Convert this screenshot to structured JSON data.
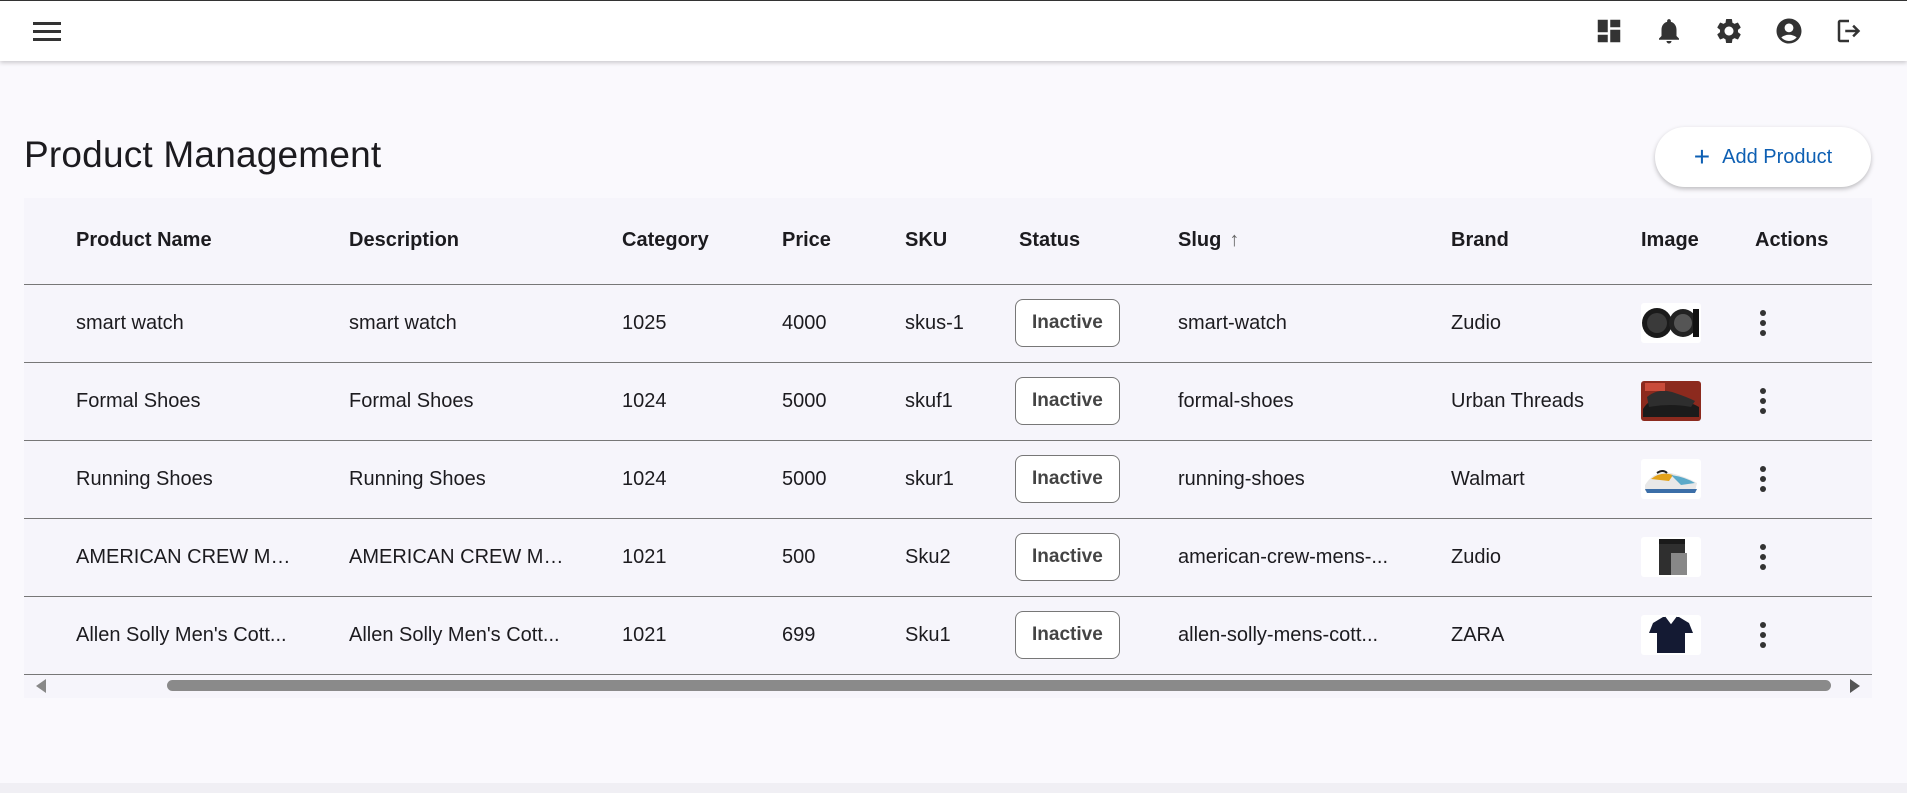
{
  "header": {
    "menu_icon": "hamburger-menu-icon",
    "icons": [
      "dashboard-icon",
      "bell-icon",
      "gear-icon",
      "account-circle-icon",
      "logout-icon"
    ]
  },
  "page": {
    "title": "Product Management",
    "add_button_label": "Add Product",
    "add_button_icon": "plus-icon",
    "accent": "#0d5fb3"
  },
  "table": {
    "columns": [
      "Product Name",
      "Description",
      "Category",
      "Price",
      "SKU",
      "Status",
      "Slug",
      "Brand",
      "Image",
      "Actions"
    ],
    "sorted_column": "Slug",
    "sort_direction": "ascending",
    "rows": [
      {
        "name": "smart watch",
        "description": "smart watch",
        "category": "1025",
        "price": "4000",
        "sku": "skus-1",
        "status": "Inactive",
        "slug": "smart-watch",
        "brand": "Zudio",
        "image": "watch-thumbnail"
      },
      {
        "name": "Formal Shoes",
        "description": "Formal Shoes",
        "category": "1024",
        "price": "5000",
        "sku": "skuf1",
        "status": "Inactive",
        "slug": "formal-shoes",
        "brand": "Urban Threads",
        "image": "formal-shoes-thumbnail"
      },
      {
        "name": "Running Shoes",
        "description": "Running Shoes",
        "category": "1024",
        "price": "5000",
        "sku": "skur1",
        "status": "Inactive",
        "slug": "running-shoes",
        "brand": "Walmart",
        "image": "running-shoes-thumbnail"
      },
      {
        "name": "AMERICAN CREW Me...",
        "description": "AMERICAN CREW Me...",
        "category": "1021",
        "price": "500",
        "sku": "Sku2",
        "status": "Inactive",
        "slug": "american-crew-mens-...",
        "brand": "Zudio",
        "image": "shorts-thumbnail"
      },
      {
        "name": "Allen Solly Men's Cott...",
        "description": "Allen Solly Men's Cott...",
        "category": "1021",
        "price": "699",
        "sku": "Sku1",
        "status": "Inactive",
        "slug": "allen-solly-mens-cott...",
        "brand": "ZARA",
        "image": "polo-shirt-thumbnail"
      }
    ]
  }
}
